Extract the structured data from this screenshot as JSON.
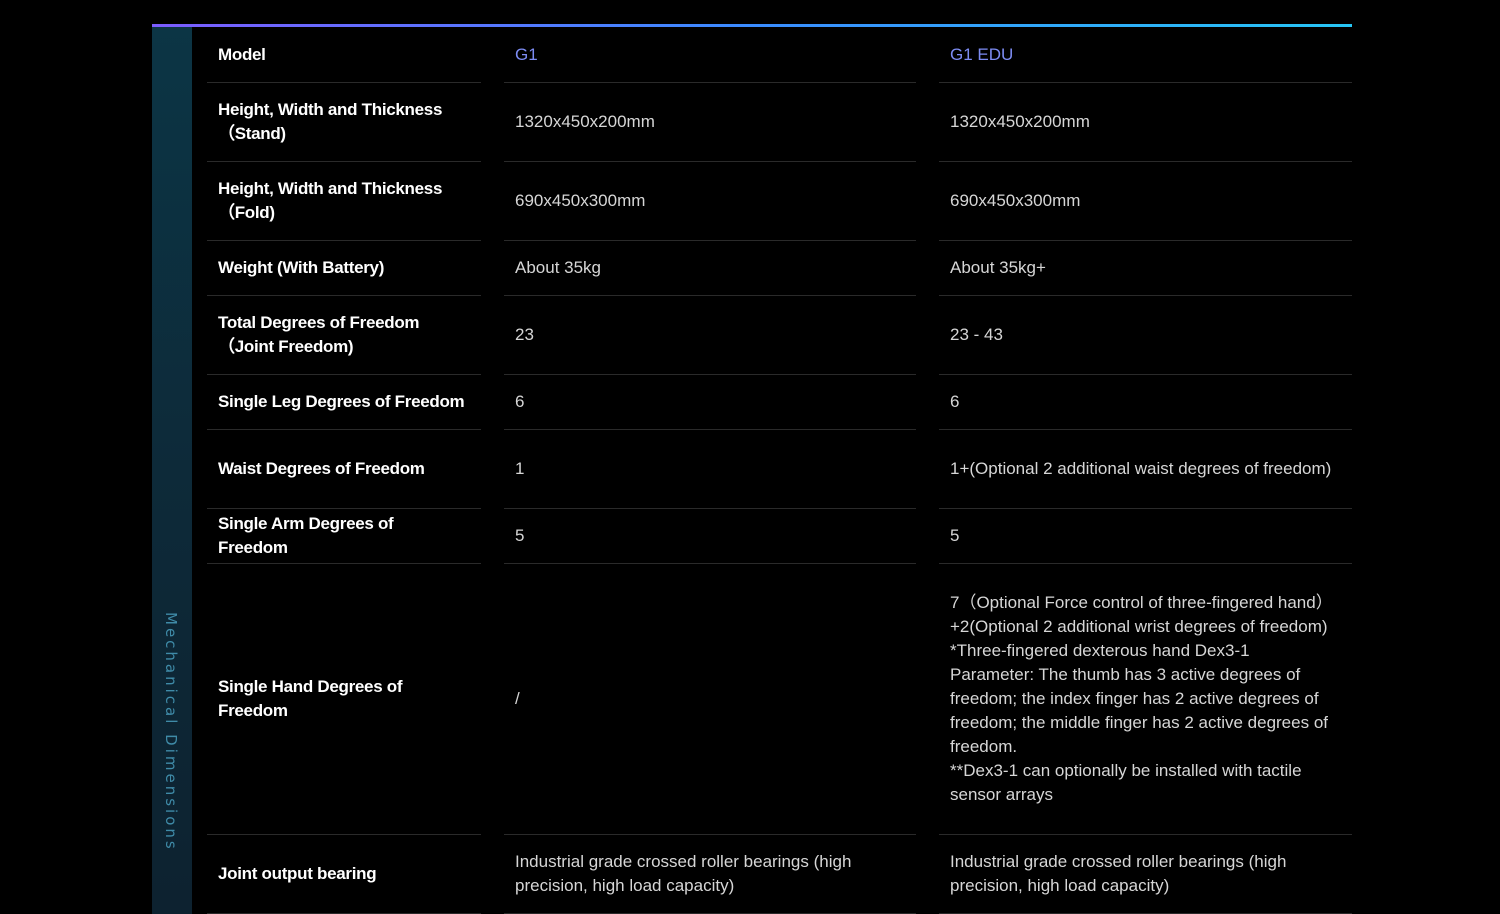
{
  "section": {
    "title": "Mechanical Dimensions"
  },
  "accent": {
    "gradient_start": "#7b5cff",
    "gradient_end": "#27c6f5",
    "model_name_color": "#7d8cf3",
    "side_band_color": "#0c3545"
  },
  "table": {
    "header": {
      "label": "Model",
      "g1": "G1",
      "edu": "G1 EDU"
    },
    "rows": [
      {
        "label": "Height, Width and Thickness （Stand)",
        "g1": "1320x450x200mm",
        "edu": "1320x450x200mm"
      },
      {
        "label": "Height, Width and Thickness （Fold)",
        "g1": "690x450x300mm",
        "edu": "690x450x300mm"
      },
      {
        "label": "Weight (With Battery)",
        "g1": "About 35kg",
        "edu": "About 35kg+"
      },
      {
        "label": "Total Degrees of Freedom（Joint Freedom)",
        "g1": "23",
        "edu": "23 - 43"
      },
      {
        "label": "Single Leg Degrees of Freedom",
        "g1": "6",
        "edu": "6"
      },
      {
        "label": "Waist Degrees of Freedom",
        "g1": "1",
        "edu": "1+(Optional 2 additional waist degrees of freedom)"
      },
      {
        "label": "Single Arm Degrees of Freedom",
        "g1": "5",
        "edu": "5"
      },
      {
        "label": "Single Hand Degrees of Freedom",
        "g1": "/",
        "edu": "7（Optional Force control of three-fingered hand）+2(Optional 2 additional wrist degrees of freedom)\n*Three-fingered dexterous hand Dex3-1 Parameter: The thumb has 3 active degrees of freedom; the index finger has 2 active degrees of freedom; the middle finger has 2 active degrees of freedom.\n**Dex3-1 can optionally be installed with tactile sensor arrays"
      },
      {
        "label": "Joint output bearing",
        "g1": "Industrial grade crossed roller bearings (high precision, high load capacity)",
        "edu": "Industrial grade crossed roller bearings (high precision, high load capacity)"
      }
    ]
  }
}
